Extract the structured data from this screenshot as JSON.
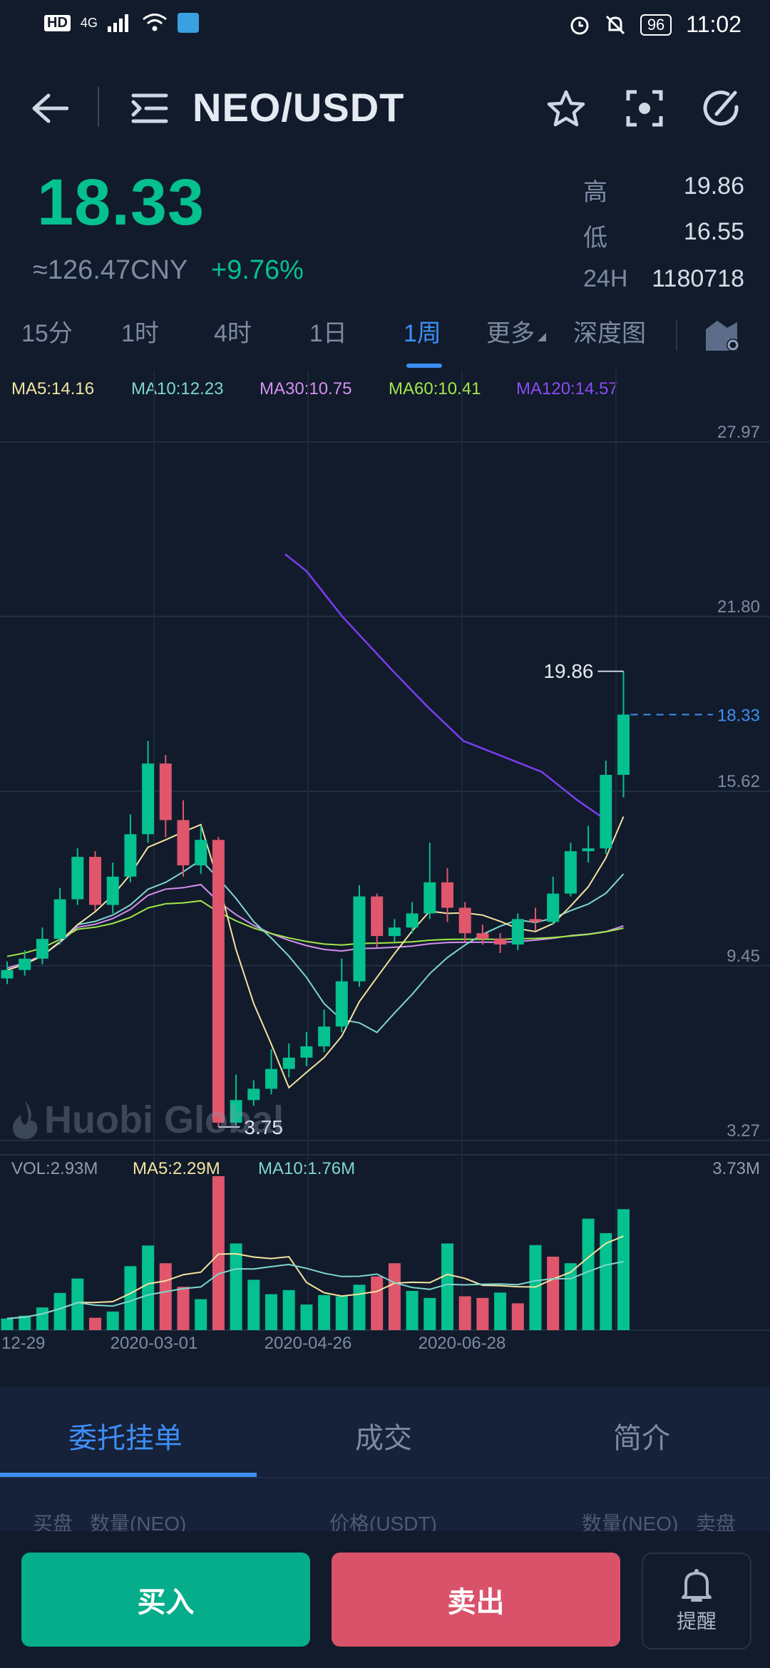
{
  "status_bar": {
    "left_text": "HD",
    "network": "4G",
    "battery": "96",
    "time": "11:02"
  },
  "header": {
    "title": "NEO/USDT",
    "icons": [
      "back-arrow-icon",
      "menu-list-icon",
      "star-icon",
      "scan-focus-icon",
      "refresh-icon"
    ]
  },
  "ticker": {
    "price": "18.33",
    "cny": "≈126.47CNY",
    "change": "+9.76%",
    "high_label": "高",
    "high": "19.86",
    "low_label": "低",
    "low": "16.55",
    "vol24h_label": "24H",
    "vol24h": "1180718"
  },
  "timeframes": [
    {
      "label": "15分",
      "active": false
    },
    {
      "label": "1时",
      "active": false
    },
    {
      "label": "4时",
      "active": false
    },
    {
      "label": "1日",
      "active": false
    },
    {
      "label": "1周",
      "active": true
    },
    {
      "label": "更多",
      "active": false
    },
    {
      "label": "深度图",
      "active": false
    }
  ],
  "ma_legend": {
    "ma5": "MA5:14.16",
    "ma10": "MA10:12.23",
    "ma30": "MA30:10.75",
    "ma60": "MA60:10.41",
    "ma120": "MA120:14.57"
  },
  "vol_legend": {
    "vol": "VOL:2.93M",
    "ma5": "MA5:2.29M",
    "ma10": "MA10:1.76M",
    "max": "3.73M"
  },
  "watermark": "Huobi Global",
  "colors": {
    "up": "#05c08f",
    "down": "#e0566c",
    "accent": "#3d8ff5",
    "ma5": "#f3e3a1",
    "ma10": "#7fd6cf",
    "ma30": "#d590f0",
    "ma60": "#a2e64a",
    "ma120": "#7b3df0"
  },
  "chart_data": {
    "type": "candlestick",
    "y_ticks": [
      "27.97",
      "21.80",
      "15.62",
      "9.45",
      "3.27"
    ],
    "y_range": [
      3.27,
      27.97
    ],
    "x_labels": [
      "12-29",
      "2020-03-01",
      "2020-04-26",
      "2020-06-28"
    ],
    "last_price": "18.33",
    "high_marker": "19.86",
    "low_marker": "3.75",
    "candles": [
      [
        9.0,
        9.3,
        9.6,
        8.8
      ],
      [
        9.3,
        9.7,
        10.0,
        9.1
      ],
      [
        9.7,
        10.4,
        10.8,
        9.5
      ],
      [
        10.4,
        11.8,
        12.2,
        10.2
      ],
      [
        11.8,
        13.3,
        13.6,
        11.6
      ],
      [
        13.3,
        11.6,
        13.5,
        11.4
      ],
      [
        11.6,
        12.6,
        13.1,
        11.3
      ],
      [
        12.6,
        14.1,
        14.8,
        12.4
      ],
      [
        14.1,
        16.6,
        17.4,
        13.8
      ],
      [
        16.6,
        14.6,
        16.9,
        14.0
      ],
      [
        14.6,
        13.0,
        15.3,
        12.6
      ],
      [
        13.0,
        13.9,
        14.4,
        12.7
      ],
      [
        13.9,
        3.9,
        14.0,
        3.75
      ],
      [
        3.9,
        4.7,
        5.6,
        3.8
      ],
      [
        4.7,
        5.1,
        5.4,
        4.5
      ],
      [
        5.1,
        5.8,
        6.5,
        4.9
      ],
      [
        5.8,
        6.2,
        6.7,
        5.5
      ],
      [
        6.2,
        6.6,
        7.1,
        5.9
      ],
      [
        6.6,
        7.3,
        7.9,
        6.4
      ],
      [
        7.3,
        8.9,
        9.7,
        7.1
      ],
      [
        8.9,
        11.9,
        12.3,
        8.7
      ],
      [
        11.9,
        10.5,
        12.0,
        10.1
      ],
      [
        10.5,
        10.8,
        11.1,
        10.3
      ],
      [
        10.8,
        11.3,
        11.7,
        10.6
      ],
      [
        11.3,
        12.4,
        13.8,
        11.1
      ],
      [
        12.4,
        11.5,
        12.9,
        11.0
      ],
      [
        11.5,
        10.6,
        11.7,
        10.3
      ],
      [
        10.6,
        10.4,
        10.9,
        10.2
      ],
      [
        10.4,
        10.2,
        10.6,
        9.9
      ],
      [
        10.2,
        11.1,
        11.3,
        10.0
      ],
      [
        11.1,
        11.0,
        11.5,
        10.7
      ],
      [
        11.0,
        12.0,
        12.6,
        10.9
      ],
      [
        12.0,
        13.5,
        13.8,
        11.9
      ],
      [
        13.5,
        13.6,
        14.4,
        13.1
      ],
      [
        13.6,
        16.2,
        16.7,
        13.4
      ],
      [
        16.2,
        18.33,
        19.86,
        15.4
      ]
    ],
    "volume": [
      0.28,
      0.35,
      0.55,
      0.9,
      1.25,
      0.3,
      0.45,
      1.55,
      2.05,
      1.62,
      1.05,
      0.75,
      3.73,
      2.1,
      1.22,
      0.87,
      0.97,
      0.62,
      0.85,
      0.82,
      1.1,
      1.3,
      1.62,
      0.95,
      0.78,
      2.1,
      0.82,
      0.78,
      0.91,
      0.65,
      2.06,
      1.78,
      1.62,
      2.7,
      2.35,
      2.93
    ],
    "vol_up": [
      true,
      true,
      true,
      true,
      true,
      false,
      true,
      true,
      true,
      false,
      false,
      true,
      false,
      true,
      true,
      true,
      true,
      true,
      true,
      true,
      true,
      false,
      false,
      true,
      true,
      true,
      false,
      false,
      true,
      false,
      true,
      false,
      true,
      true,
      true,
      true
    ]
  },
  "bottom_tabs": [
    {
      "label": "委托挂单",
      "active": true
    },
    {
      "label": "成交",
      "active": false
    },
    {
      "label": "简介",
      "active": false
    }
  ],
  "orderbook_header": {
    "bid": "买盘",
    "qty_left": "数量(NEO)",
    "price": "价格(USDT)",
    "qty_right": "数量(NEO)",
    "ask": "卖盘"
  },
  "actions": {
    "buy": "买入",
    "sell": "卖出",
    "alert": "提醒"
  }
}
